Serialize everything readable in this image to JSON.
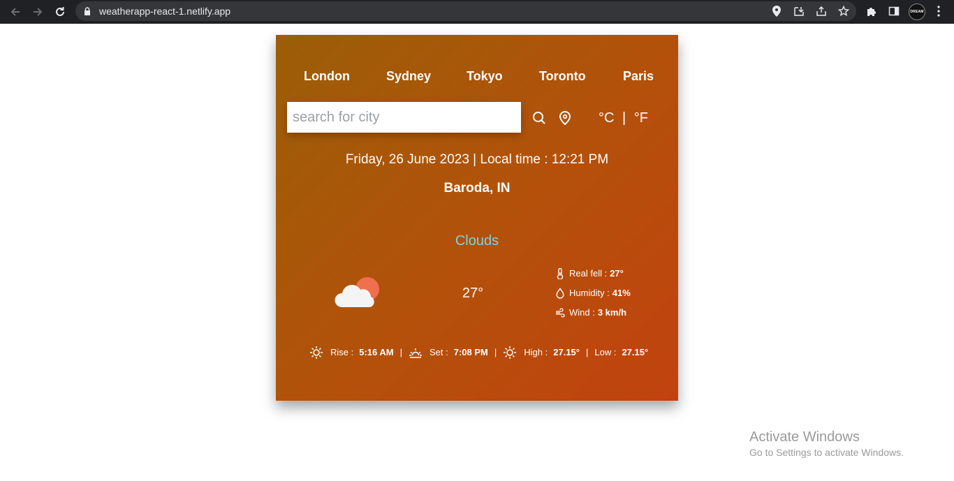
{
  "browser": {
    "url": "weatherapp-react-1.netlify.app",
    "profile_label": "DREAM"
  },
  "cities": [
    "London",
    "Sydney",
    "Tokyo",
    "Toronto",
    "Paris"
  ],
  "search": {
    "placeholder": "search for city",
    "value": ""
  },
  "units": {
    "celsius": "°C",
    "separator": "|",
    "fahrenheit": "°F"
  },
  "datetime": "Friday, 26 June 2023 | Local time : 12:21 PM",
  "location": "Baroda, IN",
  "condition": "Clouds",
  "condition_icon": "cloud-sun-icon",
  "temperature": "27°",
  "details": {
    "real_feel_label": "Real fell :",
    "real_feel_value": "27°",
    "humidity_label": "Humidity :",
    "humidity_value": "41%",
    "wind_label": "Wind :",
    "wind_value": "3 km/h"
  },
  "sun": {
    "rise_label": "Rise :",
    "rise_value": "5:16 AM",
    "set_label": "Set :",
    "set_value": "7:08 PM",
    "high_label": "High :",
    "high_value": "27.15°",
    "low_label": "Low :",
    "low_value": "27.15°",
    "separator": "|"
  },
  "overlay": {
    "title": "Activate Windows",
    "subtitle": "Go to Settings to activate Windows."
  },
  "colors": {
    "card_gradient_start": "#9b5e08",
    "card_gradient_end": "#c2420f",
    "condition_text": "#7fd1e4",
    "chrome_bg": "#202124"
  }
}
